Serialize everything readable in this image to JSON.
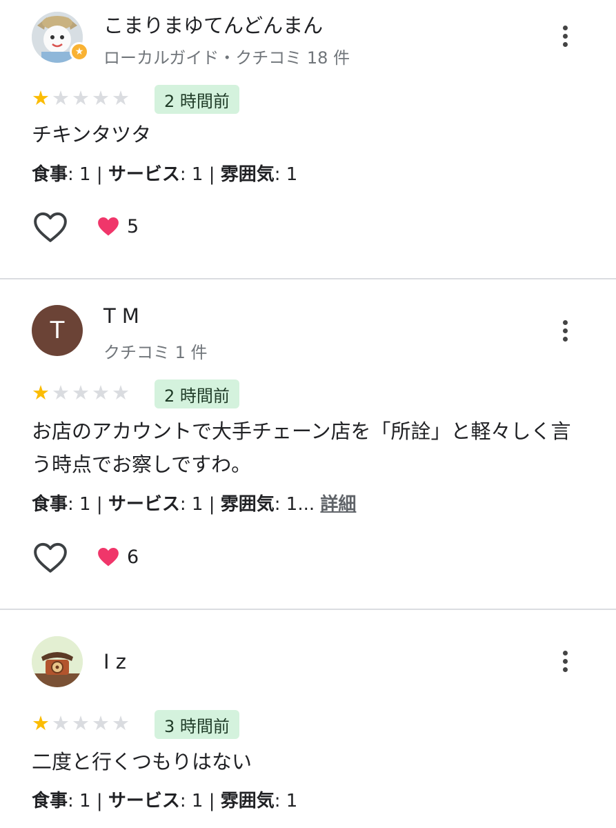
{
  "reviews": [
    {
      "name": "こまりまゆてんどんまん",
      "meta": "ローカルガイド・クチコミ 18 件",
      "time": "2 時間前",
      "text": "チキンタツタ",
      "rating_food_label": "食事",
      "rating_food": ": 1 | ",
      "rating_service_label": "サービス",
      "rating_service": ": 1 | ",
      "rating_atmosphere_label": "雰囲気",
      "rating_atmosphere": ": 1",
      "likes": "5",
      "stars": 1,
      "stars_max": 5
    },
    {
      "name": "T M",
      "avatar_letter": "T",
      "meta": "クチコミ 1 件",
      "time": "2 時間前",
      "text": "お店のアカウントで大手チェーン店を「所詮」と軽々しく言う時点でお察しですわ。",
      "rating_food_label": "食事",
      "rating_food": ": 1 | ",
      "rating_service_label": "サービス",
      "rating_service": ": 1 | ",
      "rating_atmosphere_label": "雰囲気",
      "rating_atmosphere": ": 1...",
      "more_label": "詳細",
      "likes": "6",
      "stars": 1,
      "stars_max": 5
    },
    {
      "name": "I z",
      "meta": "",
      "time": "3 時間前",
      "text": "二度と行くつもりはない",
      "rating_food_label": "食事",
      "rating_food": ": 1 | ",
      "rating_service_label": "サービス",
      "rating_service": ": 1 | ",
      "rating_atmosphere_label": "雰囲気",
      "rating_atmosphere": ": 1",
      "stars": 1,
      "stars_max": 5
    }
  ],
  "icons": {
    "star": "★",
    "local_guide_badge": "★",
    "like": "heart-outline-icon",
    "reaction": "heart-icon",
    "more": "more-vert-icon"
  },
  "colors": {
    "star_on": "#fbbc04",
    "star_off": "#dadce0",
    "time_badge_bg": "#d4f2dd",
    "avatar_tm": "#6b4336",
    "badge_guide": "#f9b233",
    "heart": "#f0366a"
  }
}
